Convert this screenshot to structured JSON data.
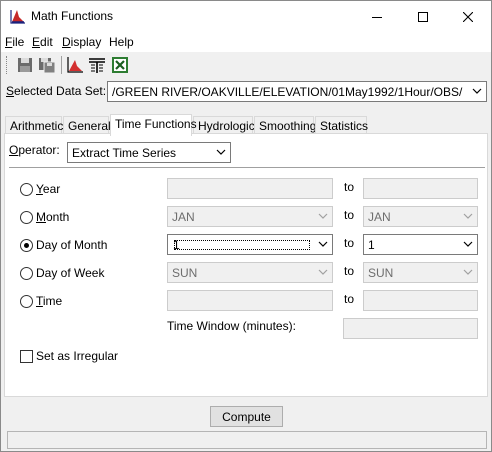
{
  "window": {
    "title": "Math Functions",
    "icon": "math-chart-icon",
    "minimize_icon": "minimize-icon",
    "maximize_icon": "maximize-icon",
    "close_icon": "close-icon"
  },
  "menu": {
    "items": [
      {
        "label": "File",
        "mnemonic": "F",
        "rest": "ile"
      },
      {
        "label": "Edit",
        "mnemonic": "E",
        "rest": "dit"
      },
      {
        "label": "Display",
        "mnemonic": "D",
        "rest": "isplay"
      },
      {
        "label": "Help",
        "mnemonic": "",
        "rest": "Help"
      }
    ]
  },
  "toolbar": {
    "buttons": [
      "save-icon",
      "save-as-icon",
      "plot-icon",
      "tabulate-icon",
      "excel-icon"
    ]
  },
  "dataset": {
    "label_mnemonic": "S",
    "label_rest": "elected Data Set:",
    "value": "/GREEN RIVER/OAKVILLE/ELEVATION/01May1992/1Hour/OBS/"
  },
  "tabs": [
    "Arithmetic",
    "General",
    "Time Functions",
    "Hydrologic",
    "Smoothing",
    "Statistics"
  ],
  "active_tab": "Time Functions",
  "operator": {
    "label_mnemonic": "O",
    "label_rest": "perator:",
    "value": "Extract Time Series"
  },
  "rows": {
    "year": {
      "mnemonic": "Y",
      "rest": "ear",
      "from": "",
      "to_label": "to",
      "to": ""
    },
    "month": {
      "mnemonic": "M",
      "rest": "onth",
      "from": "JAN",
      "to_label": "to",
      "to": "JAN"
    },
    "day_of_month": {
      "label": "Day of Month",
      "from": "1",
      "to_label": "to",
      "to": "1"
    },
    "day_of_week": {
      "label": "Day of Week",
      "from": "SUN",
      "to_label": "to",
      "to": "SUN"
    },
    "time": {
      "mnemonic": "T",
      "rest": "ime",
      "from": "",
      "to_label": "to",
      "to": ""
    }
  },
  "time_window": {
    "label": "Time Window (minutes):",
    "value": ""
  },
  "irregular": {
    "label": "Set as Irregular",
    "checked": false
  },
  "compute": {
    "label": "Compute"
  },
  "selected_radio": "day_of_month"
}
